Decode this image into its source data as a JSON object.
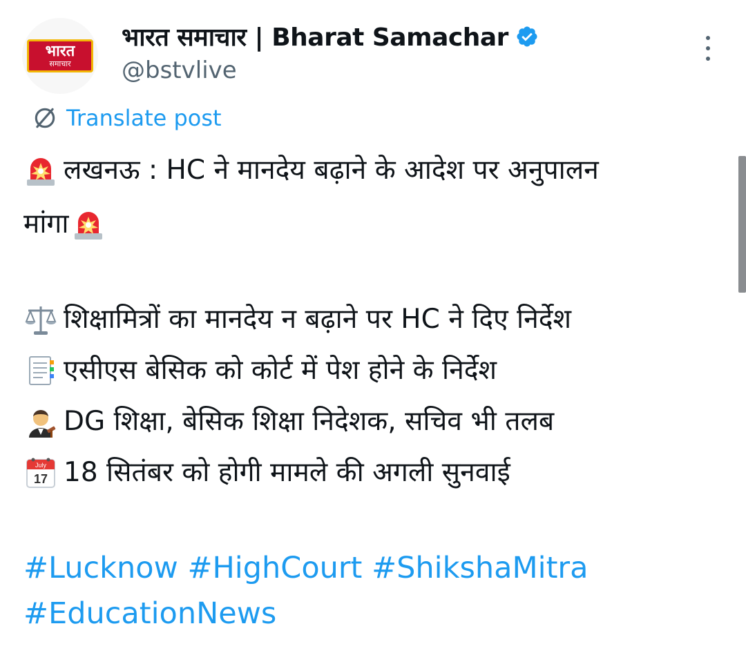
{
  "post": {
    "author": {
      "display_name": "भारत समाचार | Bharat Samachar",
      "handle": "@bstvlive",
      "verified": true,
      "avatar_logo_line1": "भारत",
      "avatar_logo_line2": "समाचार"
    },
    "translate_label": "Translate post",
    "lines": {
      "l1": "लखनऊ : HC ने मानदेय बढ़ाने के आदेश पर अनुपालन",
      "l2": "मांगा",
      "l3": "शिक्षामित्रों का मानदेय न बढ़ाने पर HC ने दिए निर्देश",
      "l4": "एसीएस बेसिक को कोर्ट में पेश होने के निर्देश",
      "l5": "DG शिक्षा, बेसिक शिक्षा निदेशक, सचिव भी तलब",
      "l6": "18 सितंबर को होगी मामले की अगली सुनवाई"
    },
    "emoji": {
      "siren": "police-car-light-icon",
      "scales": "balance-scale-icon",
      "document": "document-icon",
      "judge": "judge-icon",
      "calendar": "calendar-icon",
      "calendar_month": "July",
      "calendar_day": "17"
    },
    "hashtags": {
      "h1": "#Lucknow",
      "h2": "#HighCourt",
      "h3": "#ShikshaMitra",
      "h4": "#EducationNews"
    }
  },
  "colors": {
    "link": "#1d9bf0",
    "text": "#0f1419",
    "secondary": "#536471",
    "logo_red": "#c8102e"
  }
}
